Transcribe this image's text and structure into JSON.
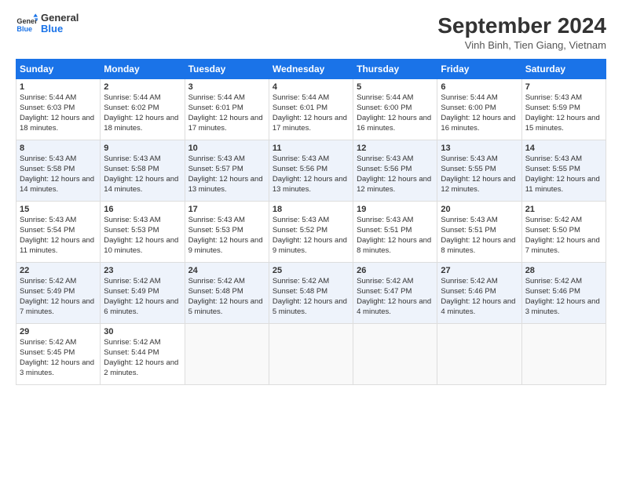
{
  "header": {
    "logo_line1": "General",
    "logo_line2": "Blue",
    "month_title": "September 2024",
    "location": "Vinh Binh, Tien Giang, Vietnam"
  },
  "days_of_week": [
    "Sunday",
    "Monday",
    "Tuesday",
    "Wednesday",
    "Thursday",
    "Friday",
    "Saturday"
  ],
  "weeks": [
    [
      {
        "day": "1",
        "sunrise": "5:44 AM",
        "sunset": "6:03 PM",
        "daylight": "12 hours and 18 minutes."
      },
      {
        "day": "2",
        "sunrise": "5:44 AM",
        "sunset": "6:02 PM",
        "daylight": "12 hours and 18 minutes."
      },
      {
        "day": "3",
        "sunrise": "5:44 AM",
        "sunset": "6:01 PM",
        "daylight": "12 hours and 17 minutes."
      },
      {
        "day": "4",
        "sunrise": "5:44 AM",
        "sunset": "6:01 PM",
        "daylight": "12 hours and 17 minutes."
      },
      {
        "day": "5",
        "sunrise": "5:44 AM",
        "sunset": "6:00 PM",
        "daylight": "12 hours and 16 minutes."
      },
      {
        "day": "6",
        "sunrise": "5:44 AM",
        "sunset": "6:00 PM",
        "daylight": "12 hours and 16 minutes."
      },
      {
        "day": "7",
        "sunrise": "5:43 AM",
        "sunset": "5:59 PM",
        "daylight": "12 hours and 15 minutes."
      }
    ],
    [
      {
        "day": "8",
        "sunrise": "5:43 AM",
        "sunset": "5:58 PM",
        "daylight": "12 hours and 14 minutes."
      },
      {
        "day": "9",
        "sunrise": "5:43 AM",
        "sunset": "5:58 PM",
        "daylight": "12 hours and 14 minutes."
      },
      {
        "day": "10",
        "sunrise": "5:43 AM",
        "sunset": "5:57 PM",
        "daylight": "12 hours and 13 minutes."
      },
      {
        "day": "11",
        "sunrise": "5:43 AM",
        "sunset": "5:56 PM",
        "daylight": "12 hours and 13 minutes."
      },
      {
        "day": "12",
        "sunrise": "5:43 AM",
        "sunset": "5:56 PM",
        "daylight": "12 hours and 12 minutes."
      },
      {
        "day": "13",
        "sunrise": "5:43 AM",
        "sunset": "5:55 PM",
        "daylight": "12 hours and 12 minutes."
      },
      {
        "day": "14",
        "sunrise": "5:43 AM",
        "sunset": "5:55 PM",
        "daylight": "12 hours and 11 minutes."
      }
    ],
    [
      {
        "day": "15",
        "sunrise": "5:43 AM",
        "sunset": "5:54 PM",
        "daylight": "12 hours and 11 minutes."
      },
      {
        "day": "16",
        "sunrise": "5:43 AM",
        "sunset": "5:53 PM",
        "daylight": "12 hours and 10 minutes."
      },
      {
        "day": "17",
        "sunrise": "5:43 AM",
        "sunset": "5:53 PM",
        "daylight": "12 hours and 9 minutes."
      },
      {
        "day": "18",
        "sunrise": "5:43 AM",
        "sunset": "5:52 PM",
        "daylight": "12 hours and 9 minutes."
      },
      {
        "day": "19",
        "sunrise": "5:43 AM",
        "sunset": "5:51 PM",
        "daylight": "12 hours and 8 minutes."
      },
      {
        "day": "20",
        "sunrise": "5:43 AM",
        "sunset": "5:51 PM",
        "daylight": "12 hours and 8 minutes."
      },
      {
        "day": "21",
        "sunrise": "5:42 AM",
        "sunset": "5:50 PM",
        "daylight": "12 hours and 7 minutes."
      }
    ],
    [
      {
        "day": "22",
        "sunrise": "5:42 AM",
        "sunset": "5:49 PM",
        "daylight": "12 hours and 7 minutes."
      },
      {
        "day": "23",
        "sunrise": "5:42 AM",
        "sunset": "5:49 PM",
        "daylight": "12 hours and 6 minutes."
      },
      {
        "day": "24",
        "sunrise": "5:42 AM",
        "sunset": "5:48 PM",
        "daylight": "12 hours and 5 minutes."
      },
      {
        "day": "25",
        "sunrise": "5:42 AM",
        "sunset": "5:48 PM",
        "daylight": "12 hours and 5 minutes."
      },
      {
        "day": "26",
        "sunrise": "5:42 AM",
        "sunset": "5:47 PM",
        "daylight": "12 hours and 4 minutes."
      },
      {
        "day": "27",
        "sunrise": "5:42 AM",
        "sunset": "5:46 PM",
        "daylight": "12 hours and 4 minutes."
      },
      {
        "day": "28",
        "sunrise": "5:42 AM",
        "sunset": "5:46 PM",
        "daylight": "12 hours and 3 minutes."
      }
    ],
    [
      {
        "day": "29",
        "sunrise": "5:42 AM",
        "sunset": "5:45 PM",
        "daylight": "12 hours and 3 minutes."
      },
      {
        "day": "30",
        "sunrise": "5:42 AM",
        "sunset": "5:44 PM",
        "daylight": "12 hours and 2 minutes."
      },
      null,
      null,
      null,
      null,
      null
    ]
  ]
}
